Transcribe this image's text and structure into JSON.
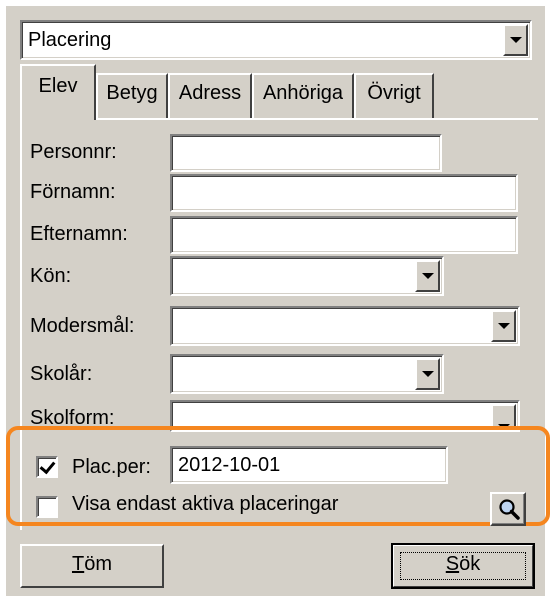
{
  "view_select": {
    "value": "Placering"
  },
  "tabs": [
    {
      "label": "Elev",
      "active": true
    },
    {
      "label": "Betyg",
      "active": false
    },
    {
      "label": "Adress",
      "active": false
    },
    {
      "label": "Anhöriga",
      "active": false
    },
    {
      "label": "Övrigt",
      "active": false
    }
  ],
  "fields": {
    "personnr": {
      "label": "Personnr:",
      "value": ""
    },
    "fornamn": {
      "label": "Förnamn:",
      "value": ""
    },
    "efternamn": {
      "label": "Efternamn:",
      "value": ""
    },
    "kon": {
      "label": "Kön:",
      "value": ""
    },
    "modersmal": {
      "label": "Modersmål:",
      "value": ""
    },
    "skolar": {
      "label": "Skolår:",
      "value": ""
    },
    "skolform": {
      "label": "Skolform:",
      "value": ""
    }
  },
  "placement": {
    "plac_per_label": "Plac.per:",
    "plac_per_checked": true,
    "plac_per_value": "2012-10-01",
    "active_only_label": "Visa endast aktiva placeringar",
    "active_only_checked": false
  },
  "buttons": {
    "clear_mnemonic": "T",
    "clear_rest": "öm",
    "search_mnemonic": "S",
    "search_rest": "ök"
  },
  "colors": {
    "dialog_face": "#d4d0c8",
    "highlight": "#f5861f"
  },
  "icons": {
    "magnifier": "search-icon",
    "dropdown": "chevron-down-icon",
    "check": "check-icon"
  }
}
